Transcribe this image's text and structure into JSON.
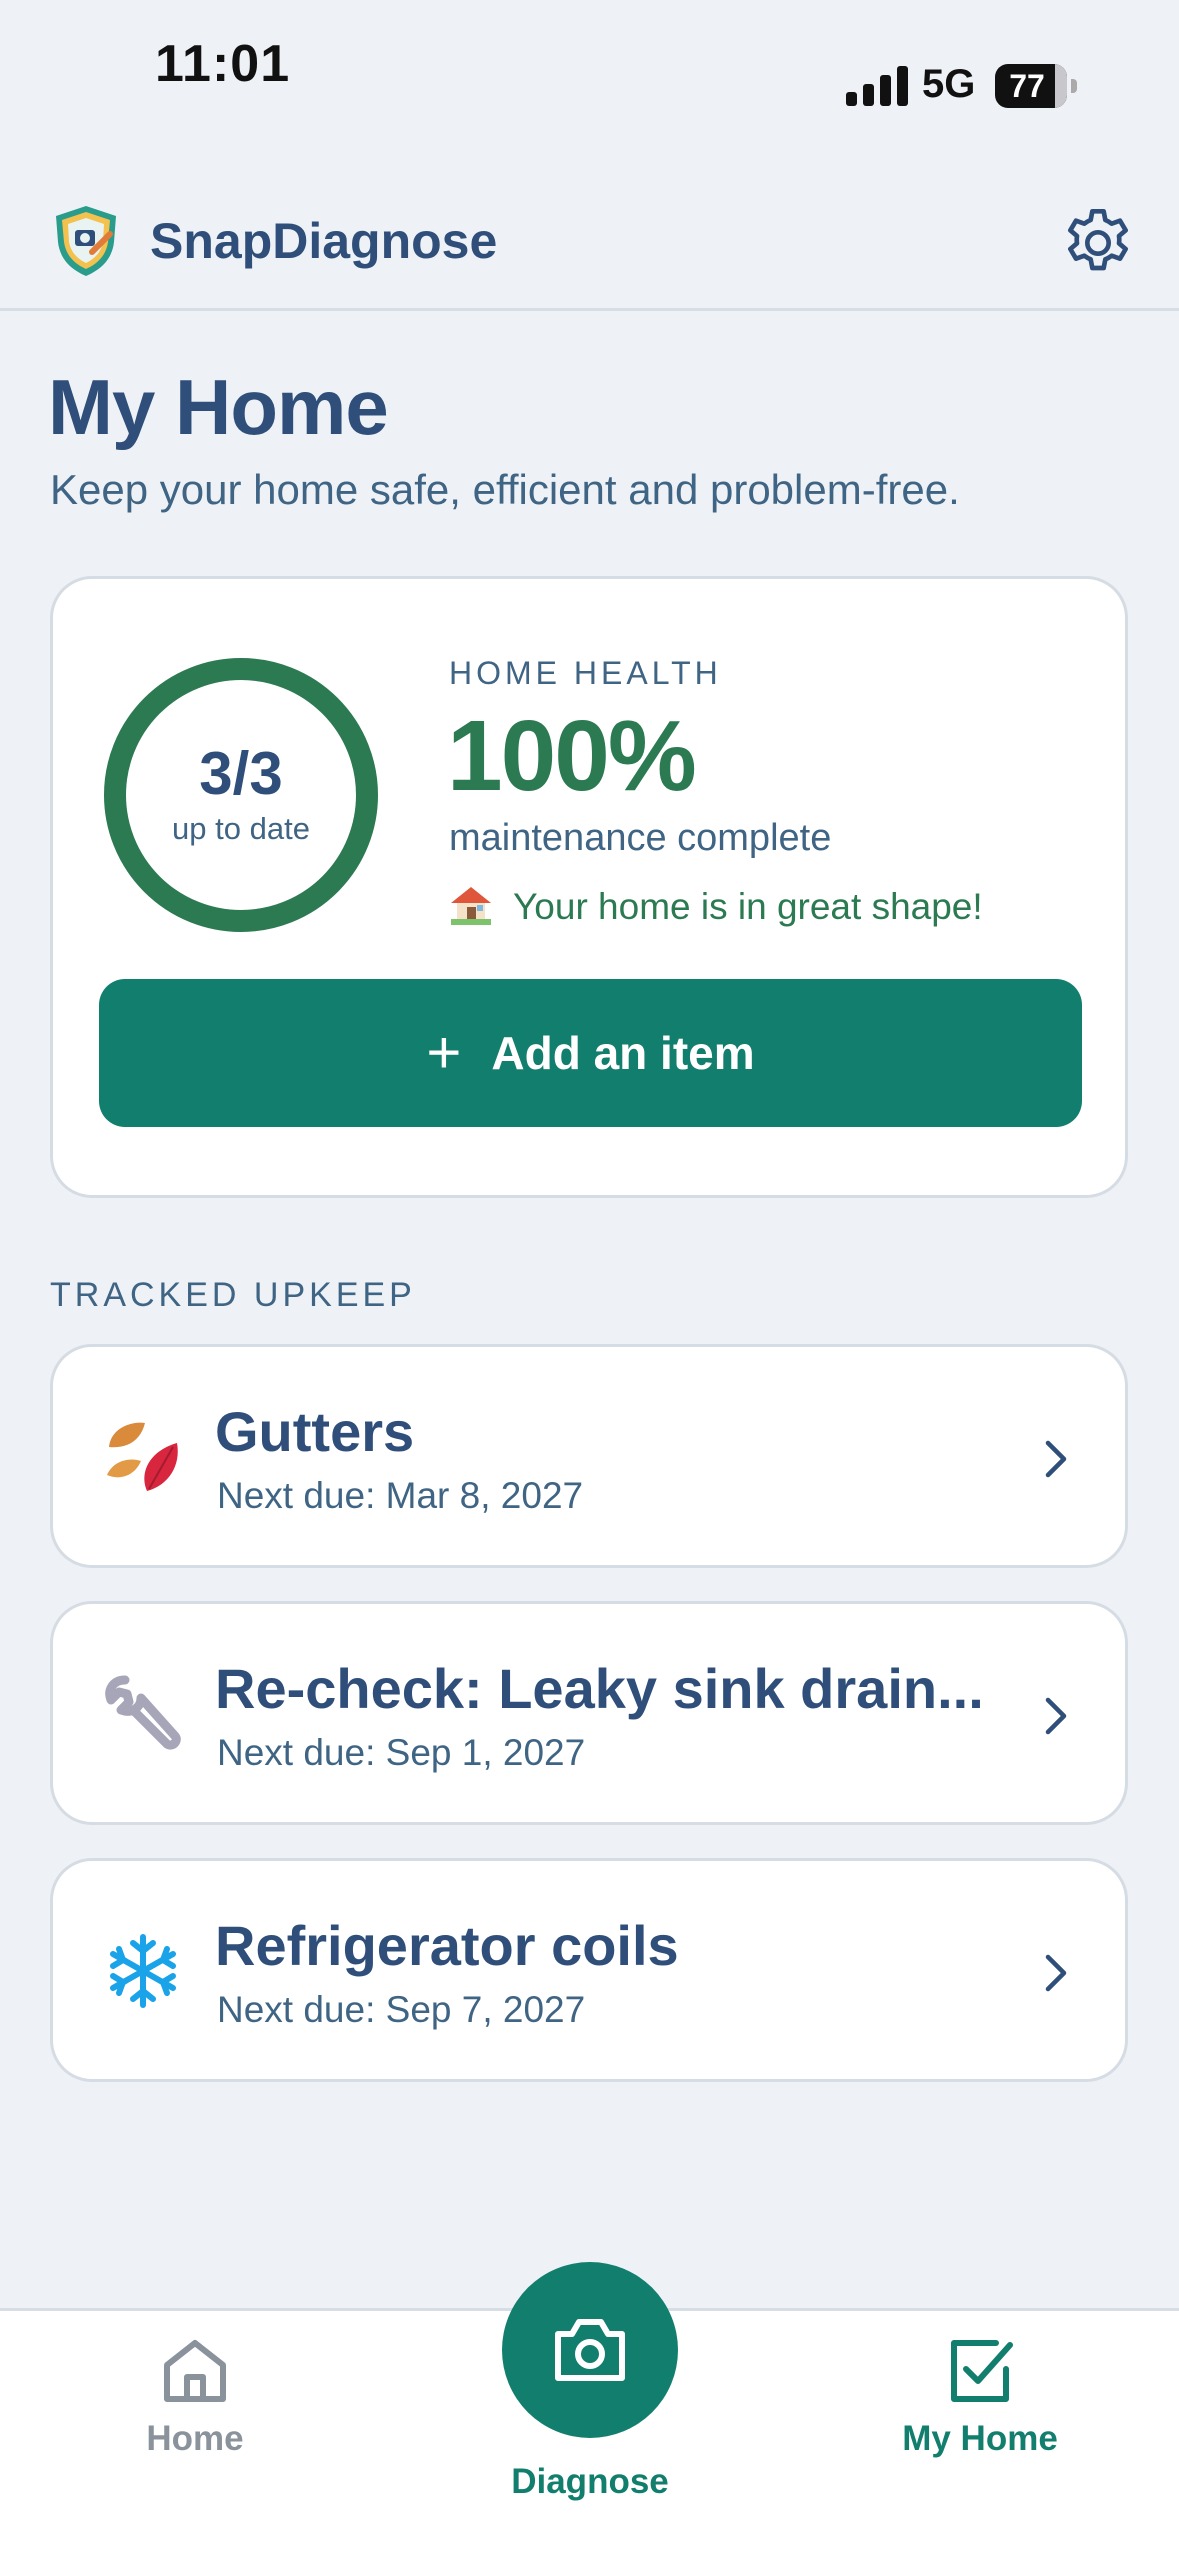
{
  "status_bar": {
    "time": "11:01",
    "network": "5G",
    "battery": "77"
  },
  "header": {
    "app_name": "SnapDiagnose",
    "settings_icon": "gear-icon"
  },
  "page": {
    "title": "My Home",
    "subtitle": "Keep your home safe, efficient and problem-free."
  },
  "health": {
    "ring_value": "3/3",
    "ring_label": "up to date",
    "ring_progress": 1.0,
    "label": "HOME HEALTH",
    "percent": "100%",
    "sub": "maintenance complete",
    "message": "Your home is in great shape!",
    "add_button": "Add an item"
  },
  "tracked": {
    "section_label": "TRACKED UPKEEP",
    "items": [
      {
        "title": "Gutters",
        "due": "Next due: Mar 8, 2027",
        "icon": "leaves-icon"
      },
      {
        "title": "Re-check: Leaky sink drain...",
        "due": "Next due: Sep 1, 2027",
        "icon": "wrench-icon"
      },
      {
        "title": "Refrigerator coils",
        "due": "Next due: Sep 7, 2027",
        "icon": "snowflake-icon"
      }
    ]
  },
  "tabs": {
    "home": "Home",
    "diagnose": "Diagnose",
    "my_home": "My Home",
    "active": "my_home"
  },
  "colors": {
    "primary": "#127e6e",
    "health_green": "#2c7a52",
    "text": "#2f4f7a"
  }
}
